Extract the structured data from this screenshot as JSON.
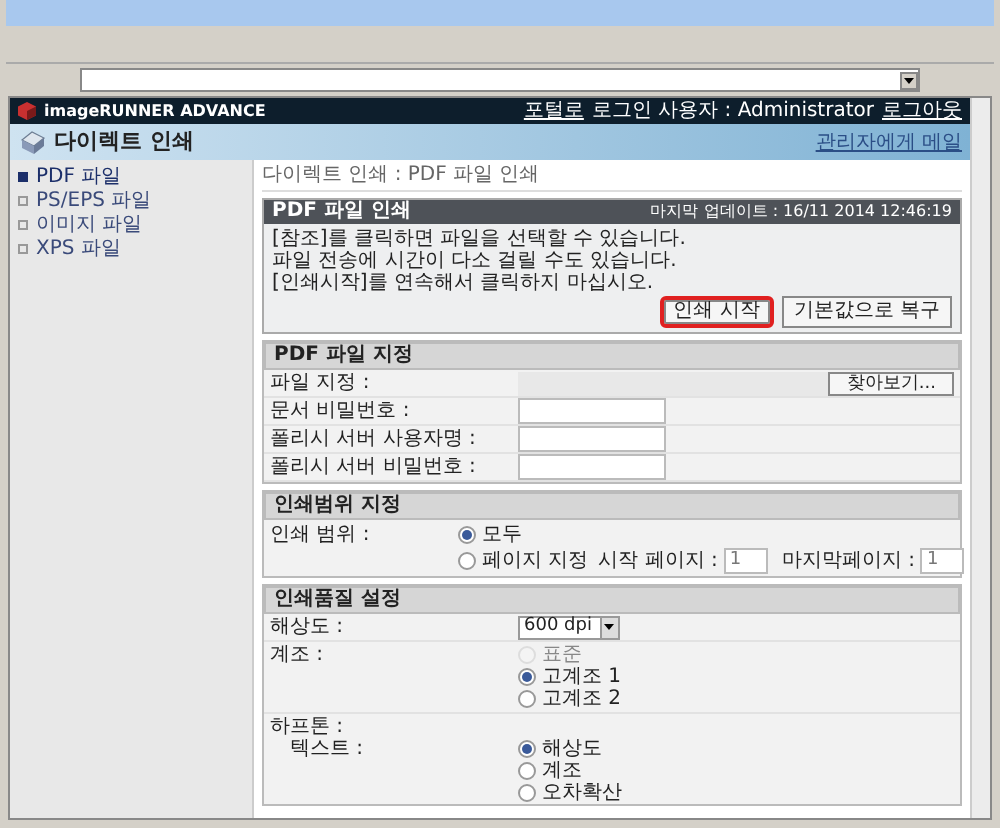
{
  "header": {
    "brand": "imageRUNNER ADVANCE",
    "links": [
      {
        "kind": "link",
        "text": "포털로"
      },
      {
        "kind": "text",
        "text": "로그인 사용자 : Administrator"
      },
      {
        "kind": "link",
        "text": "로그아웃"
      }
    ]
  },
  "banner": {
    "title": "다이렉트 인쇄",
    "mail_link": "관리자에게 메일"
  },
  "sidebar": {
    "items": [
      {
        "label": "PDF 파일",
        "selected": true
      },
      {
        "label": "PS/EPS 파일",
        "selected": false
      },
      {
        "label": "이미지 파일",
        "selected": false
      },
      {
        "label": "XPS 파일",
        "selected": false
      }
    ]
  },
  "breadcrumb": "다이렉트 인쇄 : PDF 파일 인쇄",
  "panel": {
    "title": "PDF 파일 인쇄",
    "updated": "마지막 업데이트 : 16/11 2014 12:46:19",
    "notes": [
      "[참조]를 클릭하면 파일을 선택할 수 있습니다.",
      "파일 전송에 시간이 다소 걸릴 수도 있습니다.",
      "[인쇄시작]를 연속해서 클릭하지 마십시오."
    ],
    "buttons": [
      {
        "label": "인쇄 시작",
        "highlighted": true
      },
      {
        "label": "기본값으로 복구",
        "highlighted": false
      }
    ]
  },
  "file_section": {
    "title": "PDF 파일 지정",
    "rows": [
      {
        "kind": "file",
        "label": "파일 지정 :",
        "button": "찾아보기..."
      },
      {
        "kind": "text",
        "label": "문서 비밀번호 :"
      },
      {
        "kind": "text",
        "label": "폴리시 서버 사용자명 :"
      },
      {
        "kind": "text",
        "label": "폴리시 서버 비밀번호 :"
      }
    ]
  },
  "range_section": {
    "title": "인쇄범위 지정",
    "label": "인쇄 범위 :",
    "options": [
      {
        "label": "모두",
        "selected": true
      },
      {
        "label": "페이지 지정",
        "selected": false
      }
    ],
    "start_label": "시작 페이지 :",
    "start_value": "1",
    "end_label": "마지막페이지 :",
    "end_value": "1"
  },
  "quality_section": {
    "title": "인쇄품질 설정",
    "resolution_label": "해상도 :",
    "resolution_value": "600 dpi",
    "gradation_label": "계조 :",
    "gradation": [
      {
        "label": "표준",
        "selected": false,
        "disabled": true
      },
      {
        "label": "고계조 1",
        "selected": true,
        "disabled": false
      },
      {
        "label": "고계조 2",
        "selected": false,
        "disabled": false
      }
    ],
    "halftone_label": "하프톤 :",
    "text_label": "텍스트 :",
    "text_options": [
      {
        "label": "해상도",
        "selected": true
      },
      {
        "label": "계조",
        "selected": false
      },
      {
        "label": "오차확산",
        "selected": false
      }
    ]
  }
}
